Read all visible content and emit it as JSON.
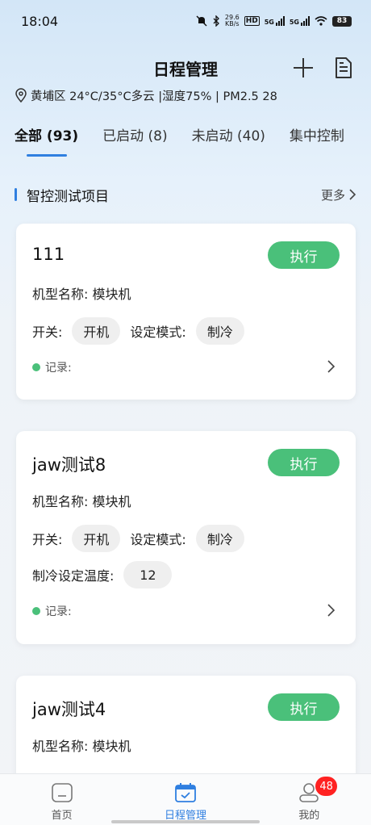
{
  "status_bar": {
    "time": "18:04",
    "net_speed": "29.6\nKB/s",
    "net_speed_top": "29.6",
    "net_speed_bottom": "KB/s",
    "hd": "HD",
    "sig1": "5G",
    "sig2": "5G",
    "battery": "83"
  },
  "header": {
    "title": "日程管理",
    "add_icon": "plus-icon",
    "doc_icon": "document-icon"
  },
  "weather": {
    "text": "黄埔区 24°C/35°C多云 |湿度75% | PM2.5 28"
  },
  "tabs": [
    {
      "label": "全部 (93)",
      "active": true
    },
    {
      "label": "已启动 (8)",
      "active": false
    },
    {
      "label": "未启动 (40)",
      "active": false
    },
    {
      "label": "集中控制",
      "active": false
    }
  ],
  "section": {
    "title": "智控测试项目",
    "more": "更多"
  },
  "labels": {
    "exec": "执行",
    "model": "机型名称: 模块机",
    "switch": "开关:",
    "mode": "设定模式:",
    "cool_temp": "制冷设定温度:",
    "record": "记录:"
  },
  "cards": [
    {
      "name": "111",
      "switch_value": "开机",
      "mode_value": "制冷"
    },
    {
      "name": "jaw测试8",
      "switch_value": "开机",
      "mode_value": "制冷",
      "temp_value": "12"
    },
    {
      "name": "jaw测试4"
    }
  ],
  "tabbar": [
    {
      "label": "首页",
      "icon": "home-icon"
    },
    {
      "label": "日程管理",
      "icon": "calendar-icon",
      "active": true
    },
    {
      "label": "我的",
      "icon": "user-icon",
      "badge": "48"
    }
  ],
  "colors": {
    "accent": "#2f7fe0",
    "exec_green": "#4ac07a",
    "badge_red": "#ff2222"
  }
}
